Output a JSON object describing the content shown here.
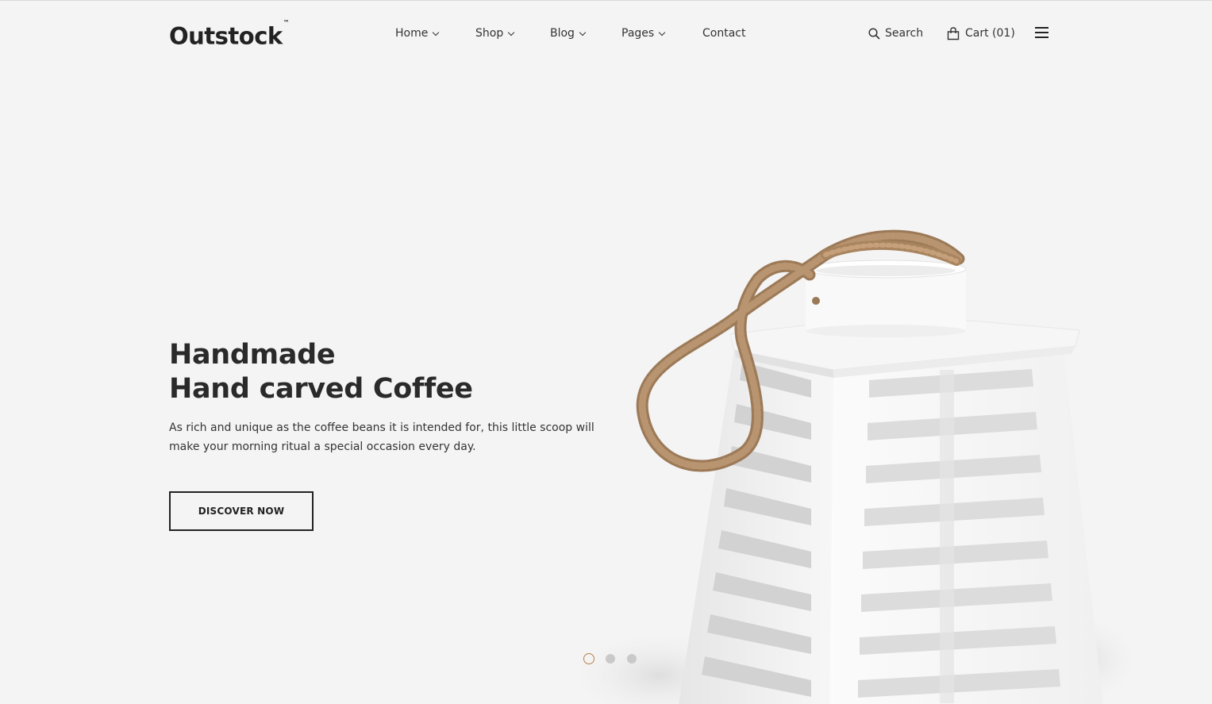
{
  "brand": {
    "name": "Outstock",
    "trademark": "™"
  },
  "nav": {
    "items": [
      {
        "label": "Home",
        "has_dropdown": true
      },
      {
        "label": "Shop",
        "has_dropdown": true
      },
      {
        "label": "Blog",
        "has_dropdown": true
      },
      {
        "label": "Pages",
        "has_dropdown": true
      },
      {
        "label": "Contact",
        "has_dropdown": false
      }
    ]
  },
  "utility": {
    "search_label": "Search",
    "cart_label": "Cart (01)",
    "search_icon": "search-icon",
    "cart_icon": "shopping-bag-icon",
    "menu_icon": "hamburger-menu-icon"
  },
  "hero": {
    "title_line1": "Handmade",
    "title_line2": "Hand carved Coffee",
    "description": "As rich and unique as the coffee beans it is intended for, this little scoop will make your morning ritual a special occasion every day.",
    "cta_label": "DISCOVER NOW"
  },
  "slider": {
    "total": 3,
    "active_index": 0
  },
  "colors": {
    "background": "#f4f4f4",
    "accent": "#b8804b",
    "text": "#222222"
  }
}
